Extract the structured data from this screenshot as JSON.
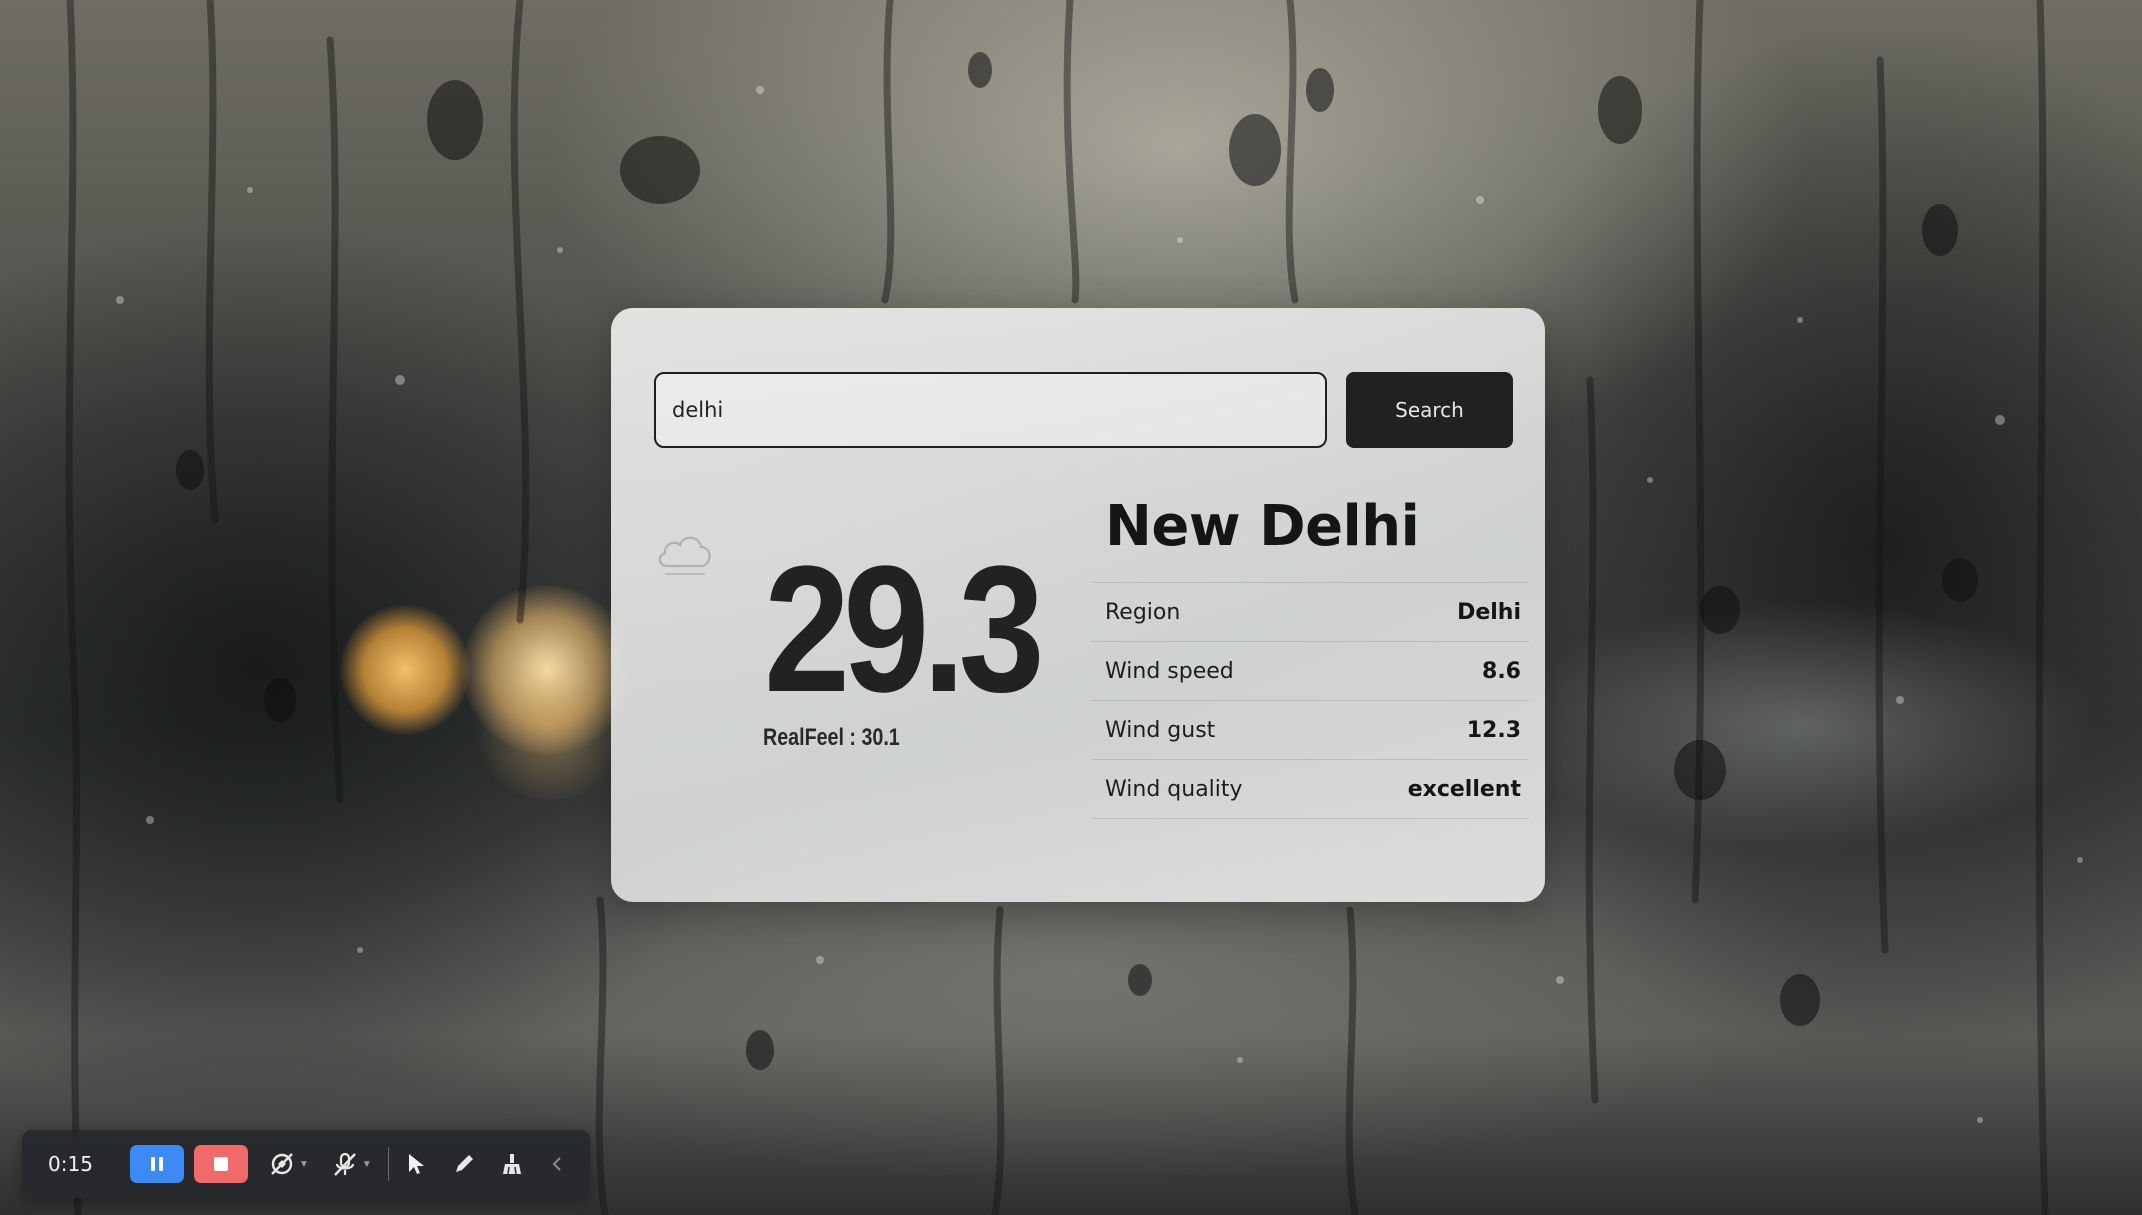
{
  "search": {
    "value": "delhi",
    "button_label": "Search"
  },
  "weather": {
    "icon": "cloud-icon",
    "temperature": "29.3",
    "realfeel": "RealFeel : 30.1",
    "city": "New Delhi",
    "details": [
      {
        "label": "Region",
        "value": "Delhi"
      },
      {
        "label": "Wind speed",
        "value": "8.6"
      },
      {
        "label": "Wind gust",
        "value": "12.3"
      },
      {
        "label": "Wind quality",
        "value": "excellent"
      }
    ]
  },
  "recorder": {
    "time": "0:15",
    "pause_color": "#3d8af7",
    "stop_color": "#f06a6a",
    "icons": [
      "pause-icon",
      "stop-icon",
      "camera-off-icon",
      "microphone-off-icon",
      "cursor-icon",
      "pen-icon",
      "eraser-icon",
      "chevron-left-icon"
    ]
  }
}
